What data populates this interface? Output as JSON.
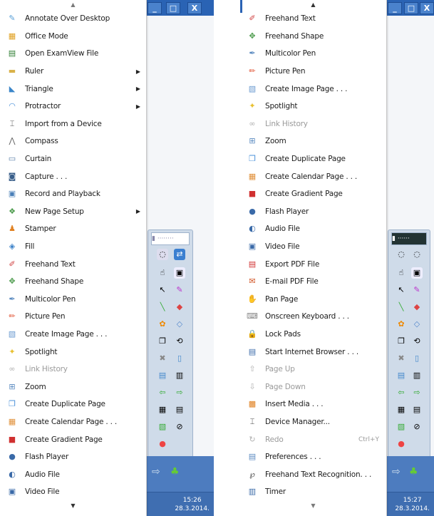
{
  "window_buttons": [
    "_",
    "□",
    "X"
  ],
  "left_panel": {
    "scroll_up": "▲",
    "scroll_down": "▼",
    "items": [
      {
        "label": "Annotate Over Desktop",
        "icon": "annotate-icon",
        "color": "#5aa0d8"
      },
      {
        "label": "Office Mode",
        "icon": "office-icon",
        "color": "#e0a020"
      },
      {
        "label": "Open ExamView File",
        "icon": "examview-icon",
        "color": "#2e7d32"
      },
      {
        "label": "Ruler",
        "icon": "ruler-icon",
        "color": "#d9b24a",
        "submenu": true
      },
      {
        "label": "Triangle",
        "icon": "triangle-icon",
        "color": "#3b86c9",
        "submenu": true
      },
      {
        "label": "Protractor",
        "icon": "protractor-icon",
        "color": "#4a90d9",
        "submenu": true
      },
      {
        "label": "Import from a Device",
        "icon": "device-icon",
        "color": "#555555"
      },
      {
        "label": "Compass",
        "icon": "compass-icon",
        "color": "#666666"
      },
      {
        "label": "Curtain",
        "icon": "curtain-icon",
        "color": "#5a7fa8"
      },
      {
        "label": "Capture . . .",
        "icon": "camera-icon",
        "color": "#3a5f8a"
      },
      {
        "label": "Record and Playback",
        "icon": "record-icon",
        "color": "#4a7fb8"
      },
      {
        "label": "New Page Setup",
        "icon": "page-setup-icon",
        "color": "#4a9a4a",
        "submenu": true
      },
      {
        "label": "Stamper",
        "icon": "stamper-icon",
        "color": "#e08020"
      },
      {
        "label": "Fill",
        "icon": "fill-icon",
        "color": "#3a80c8"
      },
      {
        "label": "Freehand Text",
        "icon": "freehand-text-icon",
        "color": "#d04040"
      },
      {
        "label": "Freehand Shape",
        "icon": "freehand-shape-icon",
        "color": "#4a9a4a"
      },
      {
        "label": "Multicolor Pen",
        "icon": "multicolor-pen-icon",
        "color": "#5a8ac0"
      },
      {
        "label": "Picture Pen",
        "icon": "picture-pen-icon",
        "color": "#e05030"
      },
      {
        "label": "Create Image Page . . .",
        "icon": "image-page-icon",
        "color": "#6a9ad0"
      },
      {
        "label": "Spotlight",
        "icon": "spotlight-icon",
        "color": "#e8c030"
      },
      {
        "label": "Link History",
        "icon": "link-history-icon",
        "color": "#b0b0b0",
        "disabled": true
      },
      {
        "label": "Zoom",
        "icon": "zoom-icon",
        "color": "#5a8ac0"
      },
      {
        "label": "Create Duplicate Page",
        "icon": "duplicate-page-icon",
        "color": "#4a90d9"
      },
      {
        "label": "Create Calendar Page . . .",
        "icon": "calendar-page-icon",
        "color": "#e0903a"
      },
      {
        "label": "Create Gradient Page",
        "icon": "gradient-page-icon",
        "color": "#d03030"
      },
      {
        "label": "Flash Player",
        "icon": "flash-player-icon",
        "color": "#3a6aa8"
      },
      {
        "label": "Audio File",
        "icon": "audio-file-icon",
        "color": "#3a6aa8"
      },
      {
        "label": "Video File",
        "icon": "video-file-icon",
        "color": "#3a6aa8"
      }
    ],
    "clock": {
      "time": "15:26",
      "date": "28.3.2014."
    }
  },
  "right_panel": {
    "scroll_up": "▲",
    "scroll_down": "▼",
    "items": [
      {
        "label": "Freehand Text",
        "icon": "freehand-text-icon",
        "color": "#d04040"
      },
      {
        "label": "Freehand Shape",
        "icon": "freehand-shape-icon",
        "color": "#4a9a4a"
      },
      {
        "label": "Multicolor Pen",
        "icon": "multicolor-pen-icon",
        "color": "#5a8ac0"
      },
      {
        "label": "Picture Pen",
        "icon": "picture-pen-icon",
        "color": "#e05030"
      },
      {
        "label": "Create Image Page . . .",
        "icon": "image-page-icon",
        "color": "#6a9ad0"
      },
      {
        "label": "Spotlight",
        "icon": "spotlight-icon",
        "color": "#e8c030"
      },
      {
        "label": "Link History",
        "icon": "link-history-icon",
        "color": "#b0b0b0",
        "disabled": true
      },
      {
        "label": "Zoom",
        "icon": "zoom-icon",
        "color": "#5a8ac0"
      },
      {
        "label": "Create Duplicate Page",
        "icon": "duplicate-page-icon",
        "color": "#4a90d9"
      },
      {
        "label": "Create Calendar Page . . .",
        "icon": "calendar-page-icon",
        "color": "#e0903a"
      },
      {
        "label": "Create Gradient Page",
        "icon": "gradient-page-icon",
        "color": "#d03030"
      },
      {
        "label": "Flash Player",
        "icon": "flash-player-icon",
        "color": "#3a6aa8"
      },
      {
        "label": "Audio File",
        "icon": "audio-file-icon",
        "color": "#3a6aa8"
      },
      {
        "label": "Video File",
        "icon": "video-file-icon",
        "color": "#3a6aa8"
      },
      {
        "label": "Export PDF File",
        "icon": "export-pdf-icon",
        "color": "#d03030"
      },
      {
        "label": "E-mail PDF File",
        "icon": "email-pdf-icon",
        "color": "#d05020"
      },
      {
        "label": "Pan Page",
        "icon": "pan-page-icon",
        "color": "#e8a030"
      },
      {
        "label": "Onscreen Keyboard . . .",
        "icon": "keyboard-icon",
        "color": "#888888"
      },
      {
        "label": "Lock Pads",
        "icon": "lock-icon",
        "color": "#e0a020"
      },
      {
        "label": "Start Internet Browser . . .",
        "icon": "browser-icon",
        "color": "#3a6aa8"
      },
      {
        "label": "Page Up",
        "icon": "page-up-icon",
        "color": "#b0b0b0",
        "disabled": true
      },
      {
        "label": "Page Down",
        "icon": "page-down-icon",
        "color": "#b0b0b0",
        "disabled": true
      },
      {
        "label": "Insert Media . . .",
        "icon": "insert-media-icon",
        "color": "#e08020"
      },
      {
        "label": "Device Manager...",
        "icon": "device-manager-icon",
        "color": "#444444"
      },
      {
        "label": "Redo",
        "icon": "redo-icon",
        "color": "#b0b0b0",
        "disabled": true,
        "shortcut": "Ctrl+Y"
      },
      {
        "label": "Preferences . . .",
        "icon": "preferences-icon",
        "color": "#5a8ac0"
      },
      {
        "label": "Freehand Text Recognition. . .",
        "icon": "text-recognition-icon",
        "color": "#444444"
      },
      {
        "label": "Timer",
        "icon": "timer-icon",
        "color": "#3a6aa8"
      }
    ],
    "clock": {
      "time": "15:27",
      "date": "28.3.2014."
    }
  }
}
